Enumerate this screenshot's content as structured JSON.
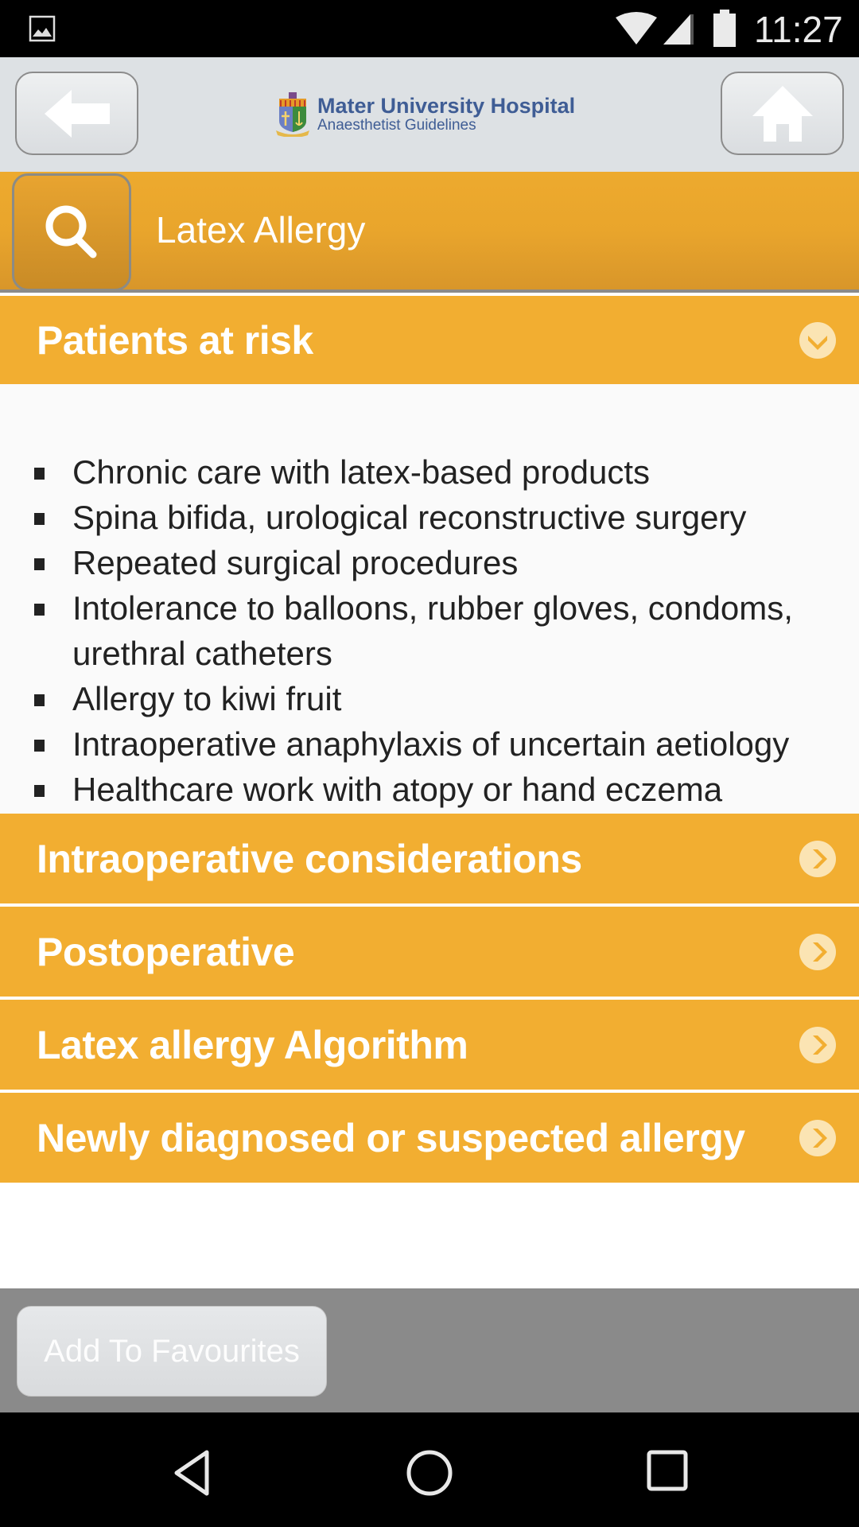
{
  "status_bar": {
    "time": "11:27",
    "icons": [
      "image-notification-icon",
      "wifi-icon",
      "cell-signal-icon",
      "battery-icon"
    ]
  },
  "header": {
    "back_icon": "arrow-left-icon",
    "home_icon": "home-icon",
    "logo_title": "Mater University Hospital",
    "logo_subtitle": "Anaesthetist Guidelines"
  },
  "search": {
    "icon": "search-icon",
    "title": "Latex Allergy"
  },
  "sections": [
    {
      "label": "Patients at risk",
      "expanded": true,
      "icon": "chevron-down-circle-icon",
      "items": [
        "Chronic care with latex-based products",
        "Spina bifida, urological reconstructive surgery",
        "Repeated surgical procedures",
        "Intolerance to balloons, rubber gloves, condoms, urethral catheters",
        "Allergy to kiwi fruit",
        "Intraoperative anaphylaxis of uncertain aetiology",
        "Healthcare work with atopy or hand eczema"
      ]
    },
    {
      "label": "Intraoperative considerations",
      "expanded": false,
      "icon": "chevron-right-circle-icon"
    },
    {
      "label": "Postoperative",
      "expanded": false,
      "icon": "chevron-right-circle-icon"
    },
    {
      "label": "Latex allergy Algorithm",
      "expanded": false,
      "icon": "chevron-right-circle-icon"
    },
    {
      "label": "Newly diagnosed or suspected allergy",
      "expanded": false,
      "icon": "chevron-right-circle-icon"
    }
  ],
  "footer": {
    "favourites_label": "Add To Favourites"
  },
  "nav_bar": {
    "buttons": [
      "back-triangle-icon",
      "home-circle-icon",
      "recents-square-icon"
    ]
  },
  "colors": {
    "accent": "#f2ae31",
    "header_bg": "#dde1e4",
    "logo_text": "#3f5d95",
    "footer_bg": "#8a8a8a"
  }
}
